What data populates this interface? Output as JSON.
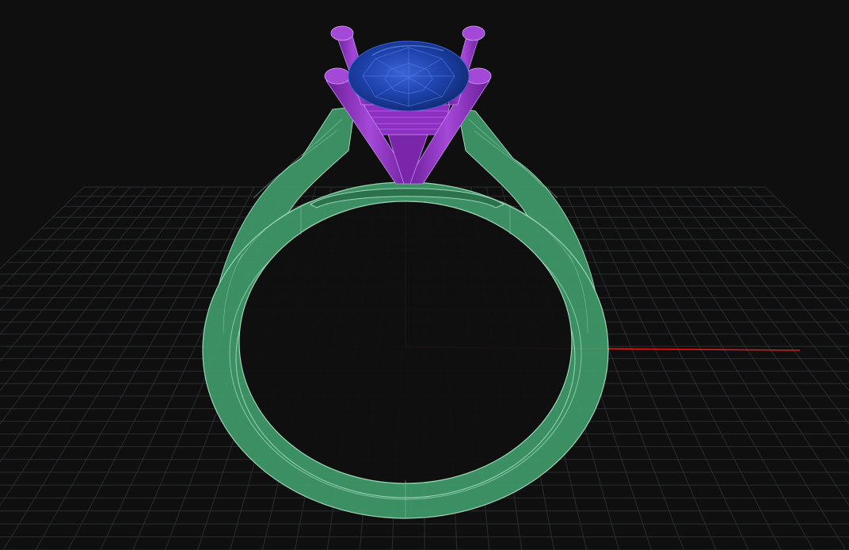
{
  "viewport": {
    "background": "#0f0f10",
    "grid": {
      "visible": true,
      "color": "#2a2d2e"
    },
    "axes": {
      "x_color": "#e01818",
      "y_color": "#18c418"
    }
  },
  "model": {
    "band_color": "#3f9a6a",
    "band_outline_color": "#a8e6c4",
    "prongs_color": "#8e2fc4",
    "gem_color": "#1c3fa6"
  }
}
